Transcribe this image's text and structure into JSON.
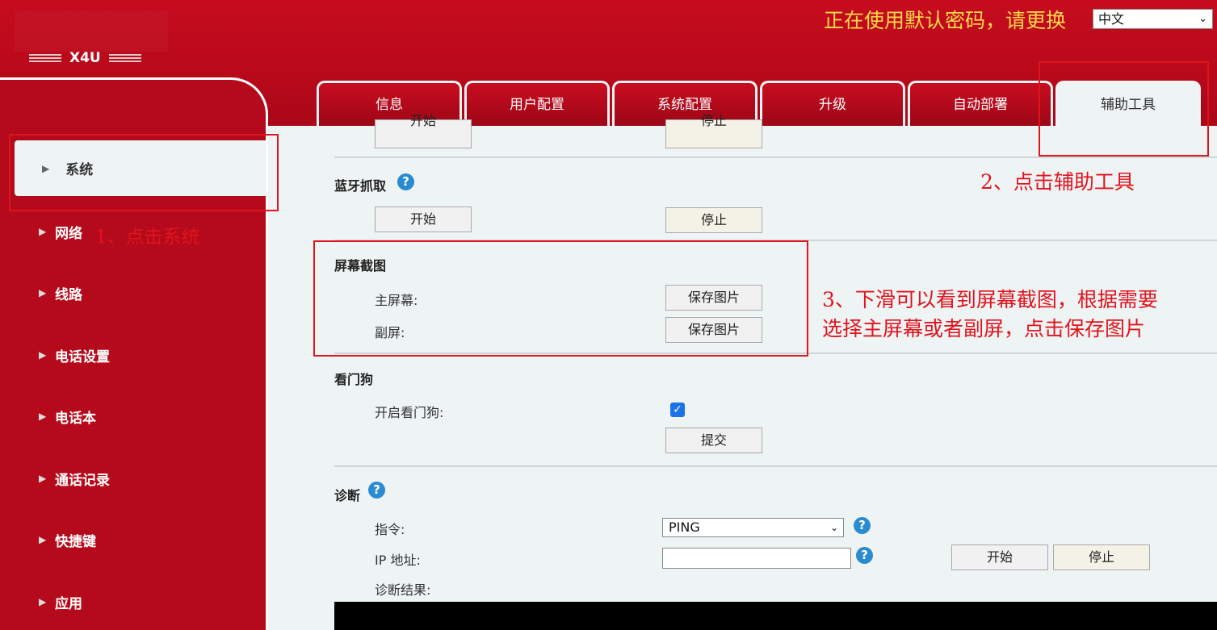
{
  "header": {
    "model_name": "X4U",
    "warning": "正在使用默认密码，请更换",
    "language": "中文"
  },
  "tabs": [
    {
      "label": "信息"
    },
    {
      "label": "用户配置"
    },
    {
      "label": "系统配置"
    },
    {
      "label": "升级"
    },
    {
      "label": "自动部署"
    },
    {
      "label": "辅助工具"
    }
  ],
  "active_tab": "辅助工具",
  "sidebar": {
    "active": "系统",
    "items": [
      {
        "label": "网络"
      },
      {
        "label": "线路"
      },
      {
        "label": "电话设置"
      },
      {
        "label": "电话本"
      },
      {
        "label": "通话记录"
      },
      {
        "label": "快捷键"
      },
      {
        "label": "应用"
      }
    ]
  },
  "content": {
    "top_partial": {
      "start": "开始",
      "stop": "停止"
    },
    "bluetooth": {
      "title": "蓝牙抓取",
      "start": "开始",
      "stop": "停止"
    },
    "screenshot": {
      "title": "屏幕截图",
      "main_label": "主屏幕:",
      "sub_label": "副屏:",
      "save_main": "保存图片",
      "save_sub": "保存图片"
    },
    "watchdog": {
      "title": "看门狗",
      "enable_label": "开启看门狗:",
      "enabled": true,
      "submit": "提交"
    },
    "diagnosis": {
      "title": "诊断",
      "command_label": "指令:",
      "command_value": "PING",
      "ip_label": "IP 地址:",
      "ip_value": "",
      "result_label": "诊断结果:",
      "start": "开始",
      "stop": "停止"
    }
  },
  "annotations": {
    "step1": "1、点击系统",
    "step2": "2、点击辅助工具",
    "step3_line1": "3、下滑可以看到屏幕截图，根据需要",
    "step3_line2": "选择主屏幕或者副屏，点击保存图片"
  },
  "colors": {
    "brand_red": "#b50a1b",
    "warning_yellow": "#ffd84a",
    "annotation_red": "#e0141e",
    "help_blue": "#2b8bd0"
  }
}
